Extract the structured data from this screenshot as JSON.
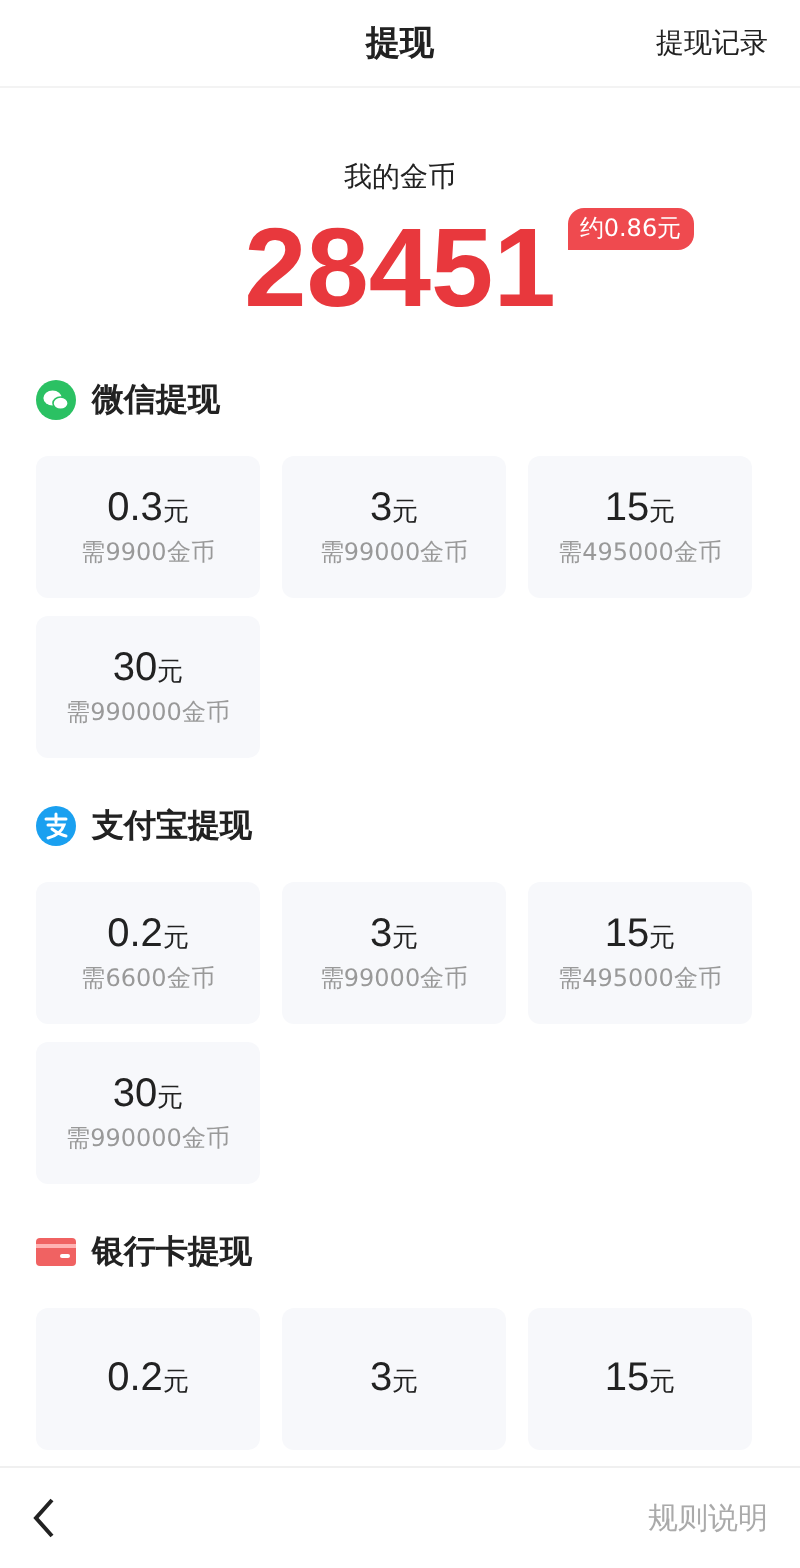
{
  "header": {
    "title": "提现",
    "link": "提现记录"
  },
  "balance": {
    "label": "我的金币",
    "amount": "28451",
    "badge": "约0.86元"
  },
  "sections": [
    {
      "kind": "wechat",
      "title": "微信提现",
      "options": [
        {
          "amount": "0.3",
          "unit": "元",
          "need": "需9900金币"
        },
        {
          "amount": "3",
          "unit": "元",
          "need": "需99000金币"
        },
        {
          "amount": "15",
          "unit": "元",
          "need": "需495000金币"
        },
        {
          "amount": "30",
          "unit": "元",
          "need": "需990000金币"
        }
      ]
    },
    {
      "kind": "alipay",
      "title": "支付宝提现",
      "options": [
        {
          "amount": "0.2",
          "unit": "元",
          "need": "需6600金币"
        },
        {
          "amount": "3",
          "unit": "元",
          "need": "需99000金币"
        },
        {
          "amount": "15",
          "unit": "元",
          "need": "需495000金币"
        },
        {
          "amount": "30",
          "unit": "元",
          "need": "需990000金币"
        }
      ]
    },
    {
      "kind": "bank",
      "title": "银行卡提现",
      "options": [
        {
          "amount": "0.2",
          "unit": "元"
        },
        {
          "amount": "3",
          "unit": "元"
        },
        {
          "amount": "15",
          "unit": "元"
        }
      ]
    }
  ],
  "footer": {
    "link": "规则说明"
  }
}
